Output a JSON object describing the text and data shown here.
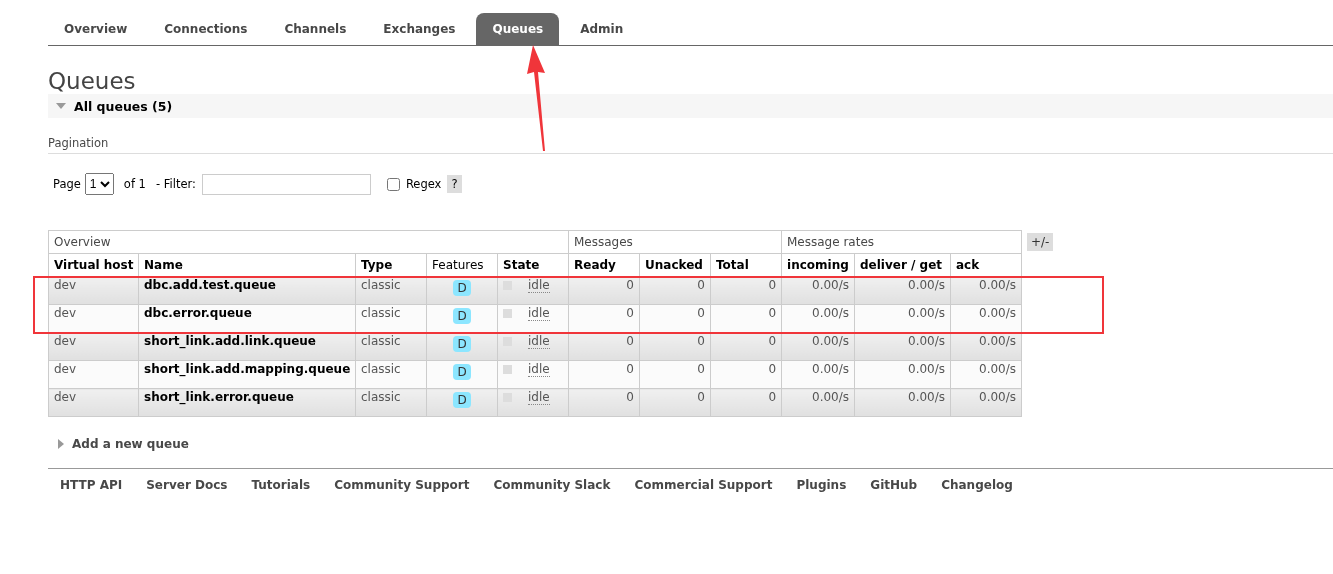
{
  "tabs": [
    {
      "label": "Overview",
      "selected": false
    },
    {
      "label": "Connections",
      "selected": false
    },
    {
      "label": "Channels",
      "selected": false
    },
    {
      "label": "Exchanges",
      "selected": false
    },
    {
      "label": "Queues",
      "selected": true
    },
    {
      "label": "Admin",
      "selected": false
    }
  ],
  "page_title": "Queues",
  "section": {
    "title": "All queues (5)",
    "expanded": true
  },
  "pagination": {
    "label": "Pagination",
    "page_label": "Page",
    "page_value": "1",
    "of_label": "of 1",
    "filter_label": "- Filter:",
    "regex_label": "Regex",
    "regex_checked": false,
    "help": "?"
  },
  "table": {
    "groups": [
      "Overview",
      "Messages",
      "Message rates"
    ],
    "columns": [
      "Virtual host",
      "Name",
      "Type",
      "Features",
      "State",
      "Ready",
      "Unacked",
      "Total",
      "incoming",
      "deliver / get",
      "ack"
    ],
    "toggle": "+/-",
    "rows": [
      {
        "vhost": "dev",
        "name": "dbc.add.test.queue",
        "type": "classic",
        "feature": "D",
        "state": "idle",
        "ready": "0",
        "unacked": "0",
        "total": "0",
        "incoming": "0.00/s",
        "deliver": "0.00/s",
        "ack": "0.00/s",
        "outlined": true
      },
      {
        "vhost": "dev",
        "name": "dbc.error.queue",
        "type": "classic",
        "feature": "D",
        "state": "idle",
        "ready": "0",
        "unacked": "0",
        "total": "0",
        "incoming": "0.00/s",
        "deliver": "0.00/s",
        "ack": "0.00/s",
        "outlined": true
      },
      {
        "vhost": "dev",
        "name": "short_link.add.link.queue",
        "type": "classic",
        "feature": "D",
        "state": "idle",
        "ready": "0",
        "unacked": "0",
        "total": "0",
        "incoming": "0.00/s",
        "deliver": "0.00/s",
        "ack": "0.00/s",
        "outlined": false
      },
      {
        "vhost": "dev",
        "name": "short_link.add.mapping.queue",
        "type": "classic",
        "feature": "D",
        "state": "idle",
        "ready": "0",
        "unacked": "0",
        "total": "0",
        "incoming": "0.00/s",
        "deliver": "0.00/s",
        "ack": "0.00/s",
        "outlined": false
      },
      {
        "vhost": "dev",
        "name": "short_link.error.queue",
        "type": "classic",
        "feature": "D",
        "state": "idle",
        "ready": "0",
        "unacked": "0",
        "total": "0",
        "incoming": "0.00/s",
        "deliver": "0.00/s",
        "ack": "0.00/s",
        "outlined": false
      }
    ]
  },
  "add_section": {
    "title": "Add a new queue",
    "expanded": false
  },
  "footer": [
    "HTTP API",
    "Server Docs",
    "Tutorials",
    "Community Support",
    "Community Slack",
    "Commercial Support",
    "Plugins",
    "GitHub",
    "Changelog"
  ]
}
